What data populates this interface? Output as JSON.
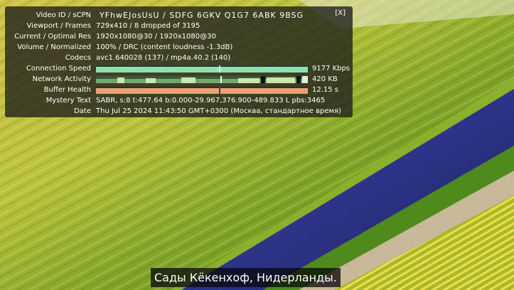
{
  "stats": {
    "close_label": "[X]",
    "rows": [
      {
        "label": "Video ID / sCPN",
        "value": "YFhwEJosUsU / SDFG 6GKV Q1G7 6ABK 9BSG"
      },
      {
        "label": "Viewport / Frames",
        "value": "729x410 / 8 dropped of 3195"
      },
      {
        "label": "Current / Optimal Res",
        "value": "1920x1080@30 / 1920x1080@30"
      },
      {
        "label": "Volume / Normalized",
        "value": "100% / DRC (content loudness -1.3dB)"
      },
      {
        "label": "Codecs",
        "value": "avc1.640028 (137) / mp4a.40.2 (140)"
      },
      {
        "label": "Connection Speed",
        "value": "9177 Kbps"
      },
      {
        "label": "Network Activity",
        "value": "420 KB"
      },
      {
        "label": "Buffer Health",
        "value": "12.15 s"
      },
      {
        "label": "Mystery Text",
        "value": "SABR, s:8 t:477.64 b:0.000-29.967,376.900-489.833 L pbs:3465"
      },
      {
        "label": "Date",
        "value": "Thu Jul 25 2024 11:43:50 GMT+0300 (Москва, стандартное время)"
      }
    ]
  },
  "graphs": {
    "connection_color": "#8fe0b0",
    "network_color": "#c8e8b0",
    "buffer_color": "#e8a278"
  },
  "subtitle": "Сады Кёкенхоф, Нидерланды."
}
